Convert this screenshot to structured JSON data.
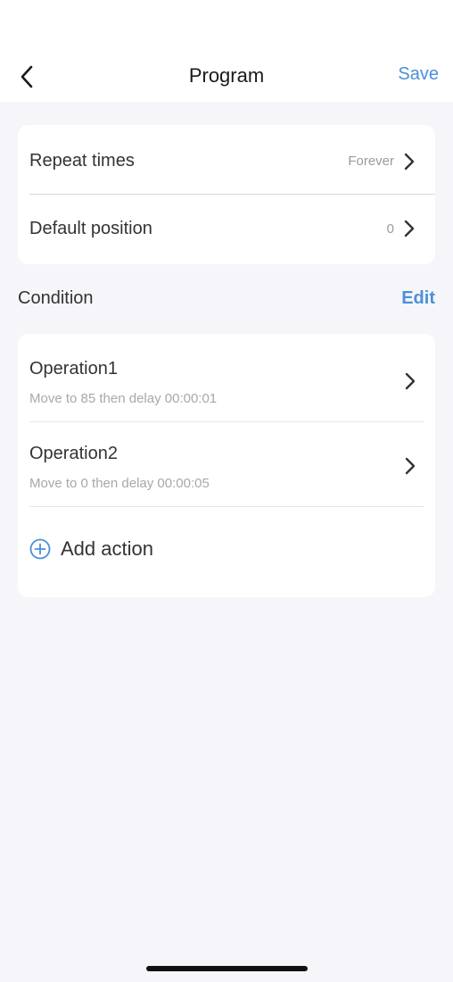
{
  "header": {
    "title": "Program",
    "save_label": "Save"
  },
  "settings": {
    "rows": [
      {
        "label": "Repeat times",
        "value": "Forever"
      },
      {
        "label": "Default position",
        "value": "0"
      }
    ]
  },
  "condition": {
    "title": "Condition",
    "edit_label": "Edit"
  },
  "operations": [
    {
      "title": "Operation1",
      "description": "Move to 85 then delay 00:00:01"
    },
    {
      "title": "Operation2",
      "description": "Move to 0 then delay 00:00:05"
    }
  ],
  "add_action": {
    "label": "Add action"
  },
  "colors": {
    "accent": "#4A90D9",
    "background": "#F6F6FA",
    "card": "#FFFFFF"
  },
  "icons": {
    "back": "chevron-left-icon",
    "row_arrow": "chevron-right-icon",
    "add": "plus-circle-icon"
  }
}
